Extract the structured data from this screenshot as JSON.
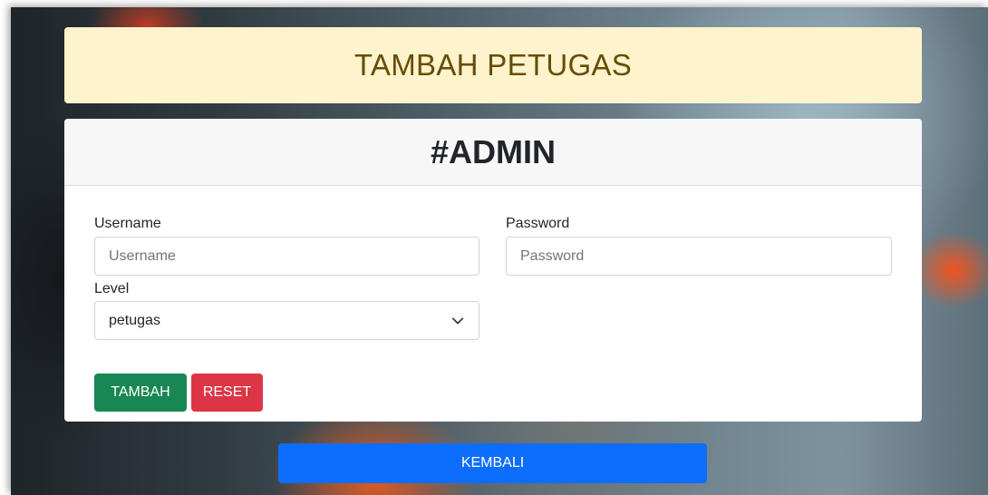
{
  "page": {
    "title": "TAMBAH PETUGAS"
  },
  "card": {
    "header": "#ADMIN"
  },
  "form": {
    "username": {
      "label": "Username",
      "placeholder": "Username",
      "value": ""
    },
    "password": {
      "label": "Password",
      "placeholder": "Password",
      "value": ""
    },
    "level": {
      "label": "Level",
      "selected": "petugas"
    },
    "buttons": {
      "submit": "TAMBAH",
      "reset": "RESET"
    }
  },
  "footer": {
    "back_label": "KEMBALI"
  },
  "icons": {
    "select_chevron": "chevron-down-icon"
  },
  "colors": {
    "title_bg": "#fff3cd",
    "title_text": "#664d03",
    "success": "#198754",
    "danger": "#dc3545",
    "primary": "#0d6efd"
  }
}
